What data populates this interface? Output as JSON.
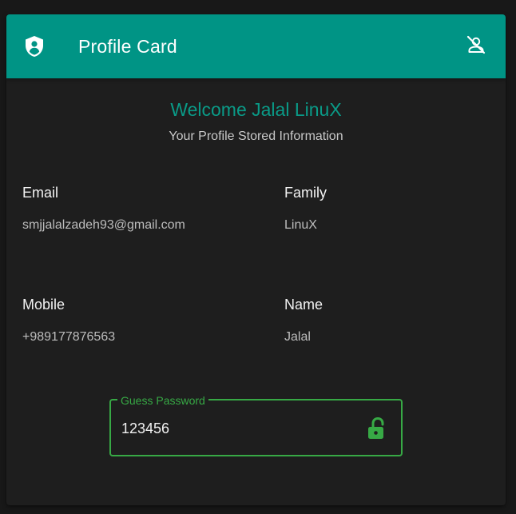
{
  "toolbar": {
    "title": "Profile Card",
    "lead_icon": "account-shield-icon",
    "action_icon": "account-off-icon"
  },
  "header": {
    "welcome": "Welcome Jalal LinuX",
    "subtitle": "Your Profile Stored Information"
  },
  "fields": [
    {
      "label": "Email",
      "value": "smjjalalzadeh93@gmail.com"
    },
    {
      "label": "Family",
      "value": "LinuX"
    },
    {
      "label": "Mobile",
      "value": "+989177876563"
    },
    {
      "label": "Name",
      "value": "Jalal"
    }
  ],
  "password": {
    "label": "Guess Password",
    "value": "123456",
    "icon": "lock-open-icon"
  },
  "colors": {
    "primary": "#009485",
    "welcome_text": "#0a9a87",
    "success": "#37a945",
    "card_background": "#1e1e1e",
    "page_background": "#181818"
  }
}
